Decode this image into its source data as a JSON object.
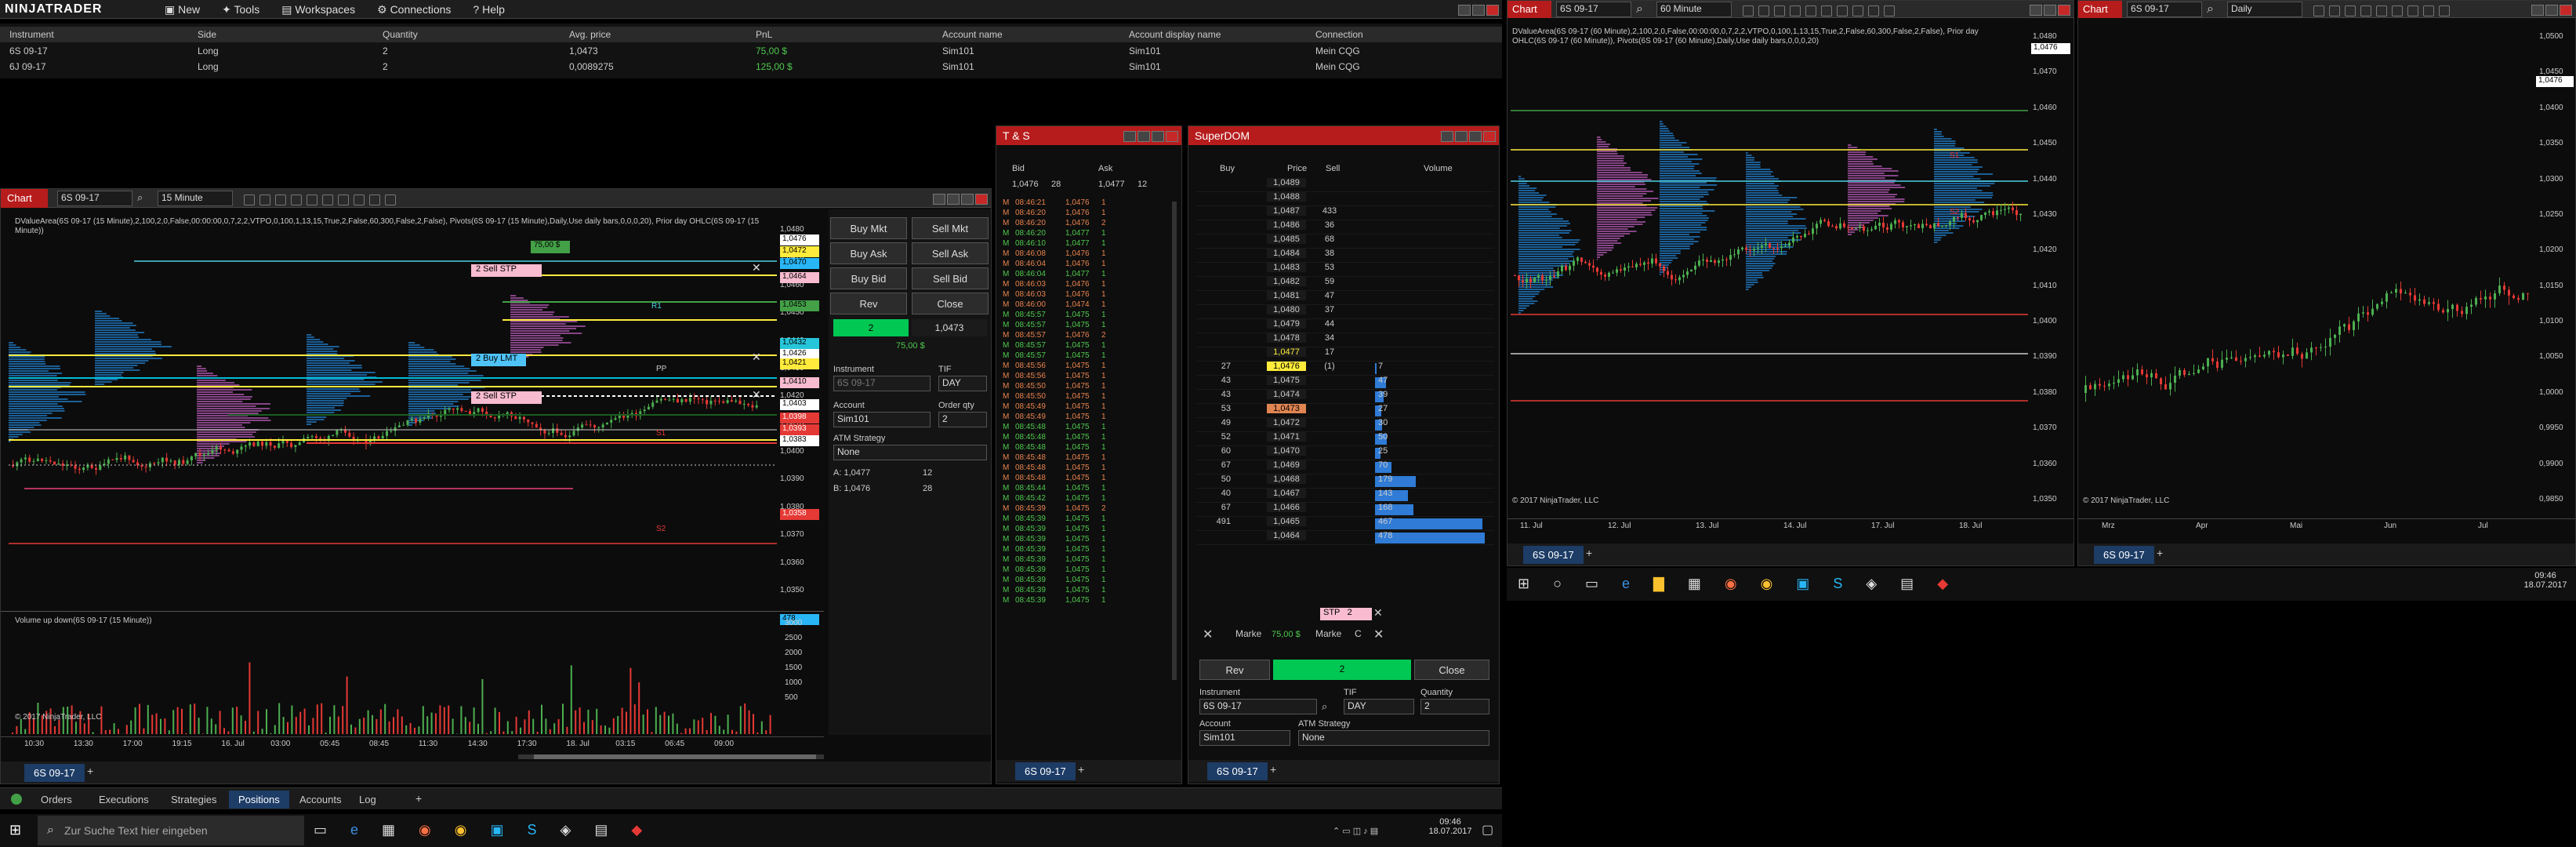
{
  "control_center": {
    "logo": "NINJATRADER",
    "menu": [
      "New",
      "Tools",
      "Workspaces",
      "Connections",
      "Help"
    ],
    "positions": {
      "headers": [
        "Instrument",
        "Side",
        "Quantity",
        "Avg. price",
        "PnL",
        "Account name",
        "Account display name",
        "Connection"
      ],
      "rows": [
        [
          "6S 09-17",
          "Long",
          "2",
          "1,0473",
          "75,00 $",
          "Sim101",
          "Sim101",
          "Mein CQG"
        ],
        [
          "6J 09-17",
          "Long",
          "2",
          "0,0089275",
          "125,00 $",
          "Sim101",
          "Sim101",
          "Mein CQG"
        ]
      ]
    },
    "tabs": [
      "Orders",
      "Executions",
      "Strategies",
      "Positions",
      "Accounts",
      "Log"
    ],
    "active_tab": "Positions"
  },
  "chart1": {
    "title": "Chart",
    "instrument": "6S 09-17",
    "interval": "15 Minute",
    "indicator": "DValueArea(6S 09-17 (15 Minute),2,100,2,0,False,00:00:00,0,7,2,2,VTPO,0,100,1,13,15,True,2,False,60,300,False,2,False), Pivots(6S 09-17 (15 Minute),Daily,Use daily bars,0,0,0,20), Prior day OHLC(6S 09-17 (15 Minute))",
    "volume_label": "Volume up down(6S 09-17 (15 Minute))",
    "copyright": "© 2017 NinjaTrader, LLC",
    "price_ticks": [
      "1,0480",
      "1,0470",
      "1,0460",
      "1,0450",
      "1,0440",
      "1,0430",
      "1,0420",
      "1,0410",
      "1,0400",
      "1,0390",
      "1,0380",
      "1,0370",
      "1,0360",
      "1,0350"
    ],
    "vol_ticks": [
      "3000",
      "2500",
      "2000",
      "1500",
      "1000",
      "500"
    ],
    "time_ticks": [
      "10:30",
      "13:30",
      "17:00",
      "19:15",
      "16. Jul",
      "03:00",
      "05:45",
      "08:45",
      "11:30",
      "14:30",
      "17:30",
      "18. Jul",
      "03:15",
      "06:45",
      "09:00"
    ],
    "orders": [
      {
        "label": "2  Sell STP"
      },
      {
        "label": "2  Buy LMT"
      },
      {
        "label": "2  Sell STP"
      }
    ],
    "pnl_flag": "75,00 $",
    "price_boxes": [
      "1,0476",
      "1,0472",
      "1,0470",
      "1,0464",
      "1,0453",
      "1,0432",
      "1,0426",
      "1,0421",
      "1,0410",
      "1,0403",
      "1,0398",
      "1,0393",
      "1,0383",
      "1,0358",
      "478"
    ],
    "pivot_labels": [
      "R1",
      "PP",
      "S1",
      "S2"
    ],
    "chart_trader": {
      "buy_mkt": "Buy Mkt",
      "sell_mkt": "Sell Mkt",
      "buy_ask": "Buy Ask",
      "sell_ask": "Sell Ask",
      "buy_bid": "Buy Bid",
      "sell_bid": "Sell Bid",
      "rev": "Rev",
      "close": "Close",
      "pos_qty": "2",
      "pos_price": "1,0473",
      "pnl": "75,00 $",
      "instrument_label": "Instrument",
      "instrument": "6S 09-17",
      "tif_label": "TIF",
      "tif": "DAY",
      "account_label": "Account",
      "account": "Sim101",
      "qty_label": "Order qty",
      "qty": "2",
      "atm_label": "ATM Strategy",
      "atm": "None",
      "ask_label": "A:",
      "ask": "1,0477",
      "ask_size": "12",
      "bid_label": "B:",
      "bid": "1,0476",
      "bid_size": "28"
    },
    "footer_tab": "6S 09-17"
  },
  "ts": {
    "title": "T & S",
    "bid_h": "Bid",
    "ask_h": "Ask",
    "bid": "1,0476",
    "bid_size": "28",
    "ask": "1,0477",
    "ask_size": "12",
    "footer_tab": "6S 09-17",
    "rows": [
      [
        "08:46:21",
        "1,0476",
        "1",
        "r"
      ],
      [
        "08:46:20",
        "1,0476",
        "1",
        "r"
      ],
      [
        "08:46:20",
        "1,0476",
        "2",
        "r"
      ],
      [
        "08:46:20",
        "1,0477",
        "1",
        "g"
      ],
      [
        "08:46:10",
        "1,0477",
        "1",
        "g"
      ],
      [
        "08:46:08",
        "1,0476",
        "1",
        "r"
      ],
      [
        "08:46:04",
        "1,0476",
        "1",
        "r"
      ],
      [
        "08:46:04",
        "1,0477",
        "1",
        "g"
      ],
      [
        "08:46:03",
        "1,0476",
        "1",
        "r"
      ],
      [
        "08:46:03",
        "1,0476",
        "1",
        "r"
      ],
      [
        "08:46:00",
        "1,0474",
        "1",
        "r"
      ],
      [
        "08:45:57",
        "1,0475",
        "1",
        "g"
      ],
      [
        "08:45:57",
        "1,0475",
        "1",
        "g"
      ],
      [
        "08:45:57",
        "1,0476",
        "2",
        "r"
      ],
      [
        "08:45:57",
        "1,0475",
        "1",
        "g"
      ],
      [
        "08:45:57",
        "1,0475",
        "1",
        "g"
      ],
      [
        "08:45:56",
        "1,0475",
        "1",
        "r"
      ],
      [
        "08:45:56",
        "1,0475",
        "1",
        "r"
      ],
      [
        "08:45:50",
        "1,0475",
        "1",
        "r"
      ],
      [
        "08:45:50",
        "1,0475",
        "1",
        "r"
      ],
      [
        "08:45:49",
        "1,0475",
        "1",
        "r"
      ],
      [
        "08:45:49",
        "1,0475",
        "1",
        "r"
      ],
      [
        "08:45:48",
        "1,0475",
        "1",
        "g"
      ],
      [
        "08:45:48",
        "1,0475",
        "1",
        "g"
      ],
      [
        "08:45:48",
        "1,0475",
        "1",
        "g"
      ],
      [
        "08:45:48",
        "1,0475",
        "1",
        "r"
      ],
      [
        "08:45:48",
        "1,0475",
        "1",
        "r"
      ],
      [
        "08:45:48",
        "1,0475",
        "1",
        "r"
      ],
      [
        "08:45:44",
        "1,0475",
        "1",
        "g"
      ],
      [
        "08:45:42",
        "1,0475",
        "1",
        "g"
      ],
      [
        "08:45:39",
        "1,0475",
        "2",
        "r"
      ],
      [
        "08:45:39",
        "1,0475",
        "1",
        "g"
      ],
      [
        "08:45:39",
        "1,0475",
        "1",
        "g"
      ],
      [
        "08:45:39",
        "1,0475",
        "1",
        "g"
      ],
      [
        "08:45:39",
        "1,0475",
        "1",
        "g"
      ],
      [
        "08:45:39",
        "1,0475",
        "1",
        "g"
      ],
      [
        "08:45:39",
        "1,0475",
        "1",
        "g"
      ],
      [
        "08:45:39",
        "1,0475",
        "1",
        "g"
      ],
      [
        "08:45:39",
        "1,0475",
        "1",
        "g"
      ],
      [
        "08:45:39",
        "1,0475",
        "1",
        "g"
      ]
    ]
  },
  "superdom": {
    "title": "SuperDOM",
    "col_buy": "Buy",
    "col_price": "Price",
    "col_sell": "Sell",
    "col_volume": "Volume",
    "rows": [
      [
        "",
        "1,0489",
        "",
        "",
        ""
      ],
      [
        "",
        "1,0488",
        "",
        "",
        ""
      ],
      [
        "",
        "1,0487",
        "433",
        "",
        ""
      ],
      [
        "",
        "1,0486",
        "36",
        "",
        ""
      ],
      [
        "",
        "1,0485",
        "68",
        "",
        ""
      ],
      [
        "",
        "1,0484",
        "38",
        "",
        ""
      ],
      [
        "",
        "1,0483",
        "53",
        "",
        ""
      ],
      [
        "",
        "1,0482",
        "59",
        "",
        ""
      ],
      [
        "",
        "1,0481",
        "47",
        "",
        ""
      ],
      [
        "",
        "1,0480",
        "37",
        "",
        ""
      ],
      [
        "",
        "1,0479",
        "44",
        "",
        ""
      ],
      [
        "",
        "1,0478",
        "34",
        "",
        ""
      ],
      [
        "",
        "1,0477",
        "17",
        "",
        ""
      ],
      [
        "27",
        "1,0476",
        "(1)",
        "7",
        ""
      ],
      [
        "43",
        "1,0475",
        "",
        "47",
        ""
      ],
      [
        "43",
        "1,0474",
        "",
        "39",
        ""
      ],
      [
        "53",
        "1,0473",
        "",
        "27",
        ""
      ],
      [
        "49",
        "1,0472",
        "",
        "30",
        ""
      ],
      [
        "52",
        "1,0471",
        "",
        "50",
        ""
      ],
      [
        "60",
        "1,0470",
        "",
        "25",
        ""
      ],
      [
        "67",
        "1,0469",
        "",
        "70",
        ""
      ],
      [
        "50",
        "1,0468",
        "",
        "179",
        ""
      ],
      [
        "40",
        "1,0467",
        "",
        "143",
        ""
      ],
      [
        "67",
        "1,0466",
        "",
        "168",
        ""
      ],
      [
        "491",
        "1,0465",
        "",
        "467",
        ""
      ],
      [
        "",
        "1,0464",
        "",
        "478",
        ""
      ]
    ],
    "stp_label": "STP",
    "stp_qty": "2",
    "marke1": "Marke",
    "pnl": "75,00 $",
    "marke2": "Marke",
    "c": "C",
    "rev": "Rev",
    "pos_qty": "2",
    "close": "Close",
    "instrument_label": "Instrument",
    "instrument": "6S 09-17",
    "tif_label": "TIF",
    "tif": "DAY",
    "qty_label": "Quantity",
    "qty": "2",
    "account_label": "Account",
    "account": "Sim101",
    "atm_label": "ATM Strategy",
    "atm": "None",
    "footer_tab": "6S 09-17"
  },
  "chart2": {
    "title": "Chart",
    "instrument": "6S 09-17",
    "interval": "60 Minute",
    "indicator": "DValueArea(6S 09-17 (60 Minute),2,100,2,0,False,00:00:00,0,7,2,2,VTPO,0,100,1,13,15,True,2,False,60,300,False,2,False), Prior day OHLC(6S 09-17 (60 Minute)), Pivots(6S 09-17 (60 Minute),Daily,Use daily bars,0,0,0,20)",
    "price_ticks": [
      "1,0480",
      "1,0470",
      "1,0460",
      "1,0450",
      "1,0440",
      "1,0430",
      "1,0420",
      "1,0410",
      "1,0400",
      "1,0390",
      "1,0380",
      "1,0370",
      "1,0360",
      "1,0350"
    ],
    "time_ticks": [
      "11. Jul",
      "12. Jul",
      "13. Jul",
      "14. Jul",
      "17. Jul",
      "18. Jul"
    ],
    "last": "1,0476",
    "s_labels": [
      "S1",
      "S2"
    ],
    "copyright": "© 2017 NinjaTrader, LLC",
    "footer_tab": "6S 09-17"
  },
  "chart3": {
    "title": "Chart",
    "instrument": "6S 09-17",
    "interval": "Daily",
    "price_ticks": [
      "1,0500",
      "1,0450",
      "1,0400",
      "1,0350",
      "1,0300",
      "1,0250",
      "1,0200",
      "1,0150",
      "1,0100",
      "1,0050",
      "1,0000",
      "0,9950",
      "0,9900",
      "0,9850"
    ],
    "time_ticks": [
      "Mrz",
      "Apr",
      "Mai",
      "Jun",
      "Jul"
    ],
    "last": "1,0476",
    "copyright": "© 2017 NinjaTrader, LLC",
    "footer_tab": "6S 09-17"
  },
  "taskbar_left": {
    "search_placeholder": "Zur Suche Text hier eingeben",
    "time": "09:46",
    "date": "18.07.2017"
  },
  "taskbar_right": {
    "time": "09:46",
    "date": "18.07.2017"
  }
}
